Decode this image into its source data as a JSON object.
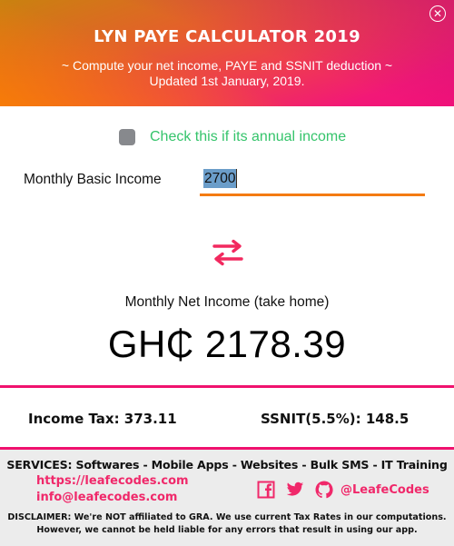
{
  "header": {
    "title": "LYN PAYE CALCULATOR 2019",
    "subtitle_line1": "~ Compute your net income, PAYE and SSNIT deduction ~",
    "subtitle_line2": "Updated 1st January, 2019.",
    "close_icon": "close-circle-icon",
    "close_glyph": "✕"
  },
  "annual_toggle": {
    "label": "Check this if its annual income",
    "checked": false
  },
  "income": {
    "label": "Monthly Basic Income",
    "value": "2700"
  },
  "swap": {
    "icon": "swap-arrows-icon"
  },
  "result": {
    "label": "Monthly Net Income (take home)",
    "value": "GH₵ 2178.39"
  },
  "breakdown": {
    "income_tax": "Income Tax: 373.11",
    "ssnit": "SSNIT(5.5%): 148.5"
  },
  "footer": {
    "services": "SERVICES: Softwares - Mobile Apps - Websites - Bulk SMS - IT Training",
    "website": "https://leafecodes.com",
    "email": "info@leafecodes.com",
    "social_icons": [
      "facebook-icon",
      "twitter-icon",
      "github-icon"
    ],
    "handle": "@LeafeCodes",
    "disclaimer_line1": "DISCLAIMER: We're NOT affiliated to GRA. We use current Tax Rates in our computations.",
    "disclaimer_line2": "However, we cannot be held liable for any errors that result in using our app."
  },
  "colors": {
    "accent_pink": "#f0126e",
    "accent_orange": "#f47b12",
    "check_label_green": "#35c46b",
    "link_pink": "#f0286a",
    "footer_bg": "#ececec"
  }
}
